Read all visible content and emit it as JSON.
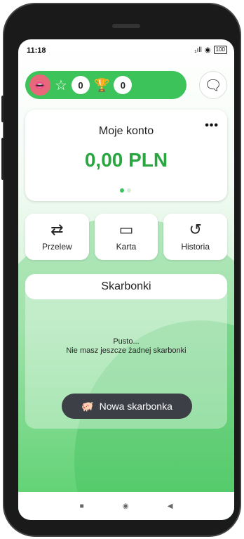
{
  "status": {
    "time": "11:18",
    "signal": "₁ıll",
    "wifi": "◉",
    "battery": "100"
  },
  "profile": {
    "stars": "0",
    "trophies": "0"
  },
  "account": {
    "title": "Moje konto",
    "amount": "0,00 PLN",
    "more": "•••"
  },
  "actions": [
    {
      "label": "Przelew",
      "icon": "⇄"
    },
    {
      "label": "Karta",
      "icon": "▭"
    },
    {
      "label": "Historia",
      "icon": "↺"
    }
  ],
  "piggy": {
    "title": "Skarbonki",
    "empty_line1": "Pusto...",
    "empty_line2": "Nie masz jeszcze żadnej skarbonki",
    "new_button": "Nowa skarbonka"
  },
  "nav": {
    "square": "■",
    "circle": "◉",
    "back": "◀"
  }
}
